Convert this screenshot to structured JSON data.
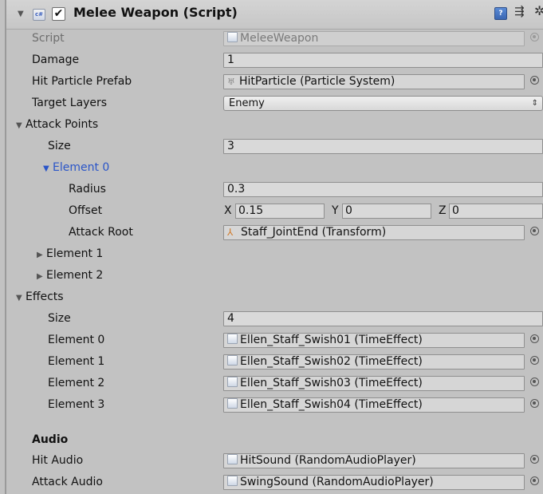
{
  "header": {
    "title": "Melee Weapon (Script)",
    "enabled": true,
    "fold_glyph": "▼",
    "check_glyph": "✔",
    "cs_glyph": "c#",
    "help_glyph": "?",
    "preset_glyph": "⇶",
    "gear_glyph": "✲"
  },
  "glyphs": {
    "expanded": "▼",
    "collapsed": "▶",
    "dropdown": "⇕",
    "particle": "♅",
    "transform": "⅄"
  },
  "fields": {
    "script": {
      "label": "Script",
      "value": "MeleeWeapon"
    },
    "damage": {
      "label": "Damage",
      "value": "1"
    },
    "hit_particle": {
      "label": "Hit Particle Prefab",
      "value": "HitParticle (Particle System)"
    },
    "target_layers": {
      "label": "Target Layers",
      "value": "Enemy"
    }
  },
  "attack_points": {
    "label": "Attack Points",
    "size_label": "Size",
    "size": "3",
    "element0": {
      "label": "Element 0",
      "radius_label": "Radius",
      "radius": "0.3",
      "offset_label": "Offset",
      "offset": {
        "x_label": "X",
        "x": "0.15",
        "y_label": "Y",
        "y": "0",
        "z_label": "Z",
        "z": "0"
      },
      "root_label": "Attack Root",
      "root": "Staff_JointEnd (Transform)"
    },
    "element1": "Element 1",
    "element2": "Element 2"
  },
  "effects": {
    "label": "Effects",
    "size_label": "Size",
    "size": "4",
    "items": [
      {
        "label": "Element 0",
        "value": "Ellen_Staff_Swish01 (TimeEffect)"
      },
      {
        "label": "Element 1",
        "value": "Ellen_Staff_Swish02 (TimeEffect)"
      },
      {
        "label": "Element 2",
        "value": "Ellen_Staff_Swish03 (TimeEffect)"
      },
      {
        "label": "Element 3",
        "value": "Ellen_Staff_Swish04 (TimeEffect)"
      }
    ]
  },
  "audio": {
    "heading": "Audio",
    "hit_label": "Hit Audio",
    "hit_value": "HitSound (RandomAudioPlayer)",
    "attack_label": "Attack Audio",
    "attack_value": "SwingSound (RandomAudioPlayer)"
  },
  "colors": {
    "panel_bg": "#c2c2c2",
    "foldout_selected": "#2a55c8",
    "field_bg": "#d9d9d9"
  }
}
